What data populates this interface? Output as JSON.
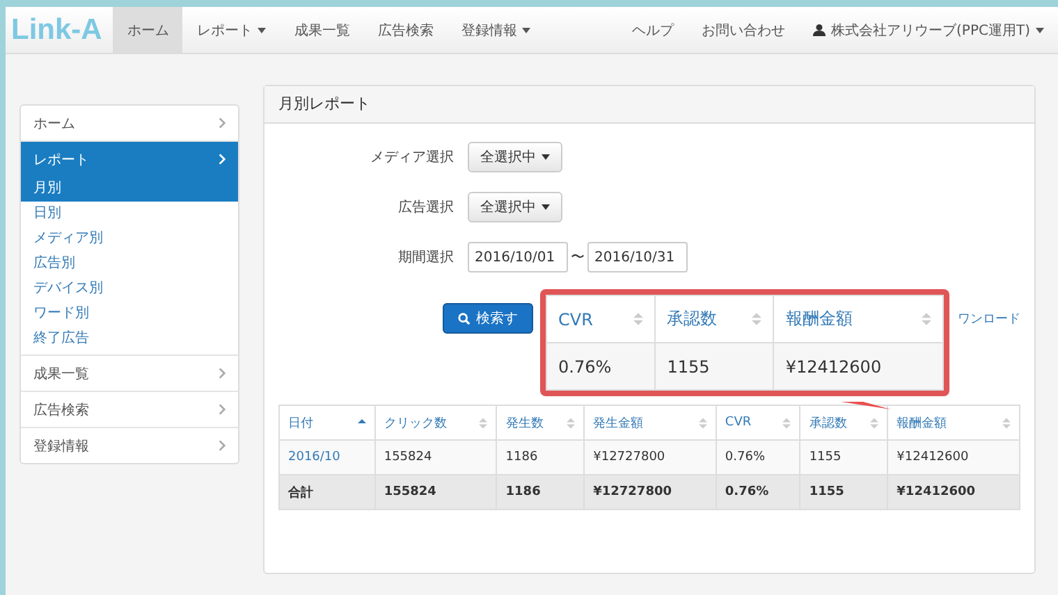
{
  "navbar": {
    "logo": "Link-A",
    "items": [
      {
        "label": "ホーム",
        "dropdown": false,
        "selected": true
      },
      {
        "label": "レポート",
        "dropdown": true,
        "selected": false
      },
      {
        "label": "成果一覧",
        "dropdown": false,
        "selected": false
      },
      {
        "label": "広告検索",
        "dropdown": false,
        "selected": false
      },
      {
        "label": "登録情報",
        "dropdown": true,
        "selected": false
      }
    ],
    "right_items": [
      {
        "label": "ヘルプ",
        "dropdown": false
      },
      {
        "label": "お問い合わせ",
        "dropdown": false
      },
      {
        "label": "株式会社アリウーブ(PPC運用T)",
        "dropdown": true,
        "user": true
      }
    ]
  },
  "sidebar": {
    "items": [
      {
        "label": "ホーム",
        "selected": false
      },
      {
        "label": "レポート",
        "selected": true,
        "children": [
          {
            "label": "月別",
            "selected": true
          },
          {
            "label": "日別",
            "selected": false
          },
          {
            "label": "メディア別",
            "selected": false
          },
          {
            "label": "広告別",
            "selected": false
          },
          {
            "label": "デバイス別",
            "selected": false
          },
          {
            "label": "ワード別",
            "selected": false
          },
          {
            "label": "終了広告",
            "selected": false
          }
        ]
      },
      {
        "label": "成果一覧",
        "selected": false
      },
      {
        "label": "広告検索",
        "selected": false
      },
      {
        "label": "登録情報",
        "selected": false
      }
    ]
  },
  "panel": {
    "title": "月別レポート",
    "form": [
      {
        "label": "メディア選択",
        "kind": "dropdown",
        "value": "全選択中"
      },
      {
        "label": "広告選択",
        "kind": "dropdown",
        "value": "全選択中"
      },
      {
        "label": "期間選択",
        "kind": "daterange",
        "from": "2016/10/01",
        "separator": "〜",
        "to": "2016/10/31"
      }
    ],
    "search_button": "検索す",
    "download_link": "ワンロード",
    "table": {
      "columns": [
        {
          "label": "日付",
          "sorted": true
        },
        {
          "label": "クリック数",
          "sorted": false
        },
        {
          "label": "発生数",
          "sorted": false
        },
        {
          "label": "発生金額",
          "sorted": false
        },
        {
          "label": "CVR",
          "sorted": false
        },
        {
          "label": "承認数",
          "sorted": false
        },
        {
          "label": "報酬金額",
          "sorted": false
        }
      ],
      "rows": [
        {
          "kind": "data",
          "cells": [
            "2016/10",
            "155824",
            "1186",
            "¥12727800",
            "0.76%",
            "1155",
            "¥12412600"
          ]
        },
        {
          "kind": "total",
          "cells": [
            "合計",
            "155824",
            "1186",
            "¥12727800",
            "0.76%",
            "1155",
            "¥12412600"
          ]
        }
      ]
    }
  },
  "callout": {
    "columns": [
      {
        "label": "CVR"
      },
      {
        "label": "承認数"
      },
      {
        "label": "報酬金額"
      }
    ],
    "cells": [
      "0.76%",
      "1155",
      "¥12412600"
    ]
  }
}
